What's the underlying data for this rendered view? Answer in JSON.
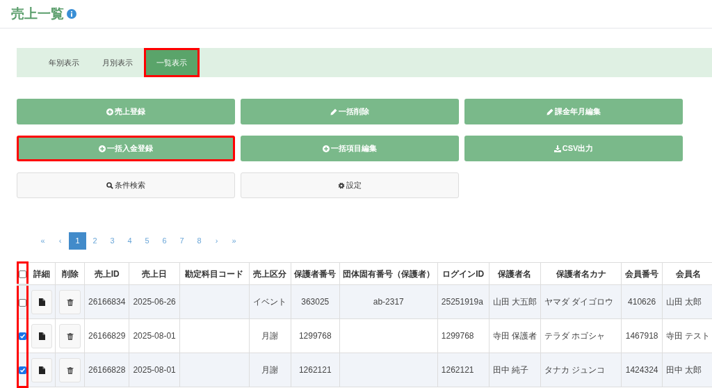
{
  "page_title": "売上一覧",
  "tabs": [
    {
      "label": "年別表示",
      "selected": false,
      "highlighted": false
    },
    {
      "label": "月別表示",
      "selected": false,
      "highlighted": false
    },
    {
      "label": "一覧表示",
      "selected": true,
      "highlighted": true
    }
  ],
  "buttons": [
    {
      "label": "売上登録",
      "highlighted": false
    },
    {
      "label": "一括削除",
      "highlighted": false
    },
    {
      "label": "課金年月編集",
      "highlighted": false
    },
    {
      "label": "一括入金登録",
      "highlighted": true
    },
    {
      "label": "一括項目編集",
      "highlighted": false
    },
    {
      "label": "CSV出力",
      "highlighted": false
    },
    {
      "label": "条件検索",
      "highlighted": false
    },
    {
      "label": "設定",
      "highlighted": false
    }
  ],
  "pagination": [
    {
      "label": "«",
      "selected": false
    },
    {
      "label": "‹",
      "selected": false
    },
    {
      "label": "1",
      "selected": true
    },
    {
      "label": "2",
      "selected": false
    },
    {
      "label": "3",
      "selected": false
    },
    {
      "label": "4",
      "selected": false
    },
    {
      "label": "5",
      "selected": false
    },
    {
      "label": "6",
      "selected": false
    },
    {
      "label": "7",
      "selected": false
    },
    {
      "label": "8",
      "selected": false
    },
    {
      "label": "›",
      "selected": false
    },
    {
      "label": "»",
      "selected": false
    }
  ],
  "table": {
    "checkbox_column_highlighted": true,
    "all_checked": false,
    "columns": [
      "詳細",
      "削除",
      "売上ID",
      "売上日",
      "勘定科目コード",
      "売上区分",
      "保護者番号",
      "団体固有番号（保護者）",
      "ログインID",
      "保護者名",
      "保護者名カナ",
      "会員番号",
      "会員名"
    ],
    "rows": [
      {
        "checked": false,
        "cells": [
          "",
          "",
          "26166834",
          "2025-06-26",
          "",
          "イベント",
          "363025",
          "ab-2317",
          "25251919a",
          "山田 大五郎",
          "ヤマダ ダイゴロウ",
          "410626",
          "山田 太郎"
        ]
      },
      {
        "checked": true,
        "cells": [
          "",
          "",
          "26166829",
          "2025-08-01",
          "",
          "月謝",
          "1299768",
          "",
          "1299768",
          "寺田 保護者",
          "テラダ ホゴシャ",
          "1467918",
          "寺田 テスト"
        ]
      },
      {
        "checked": true,
        "cells": [
          "",
          "",
          "26166828",
          "2025-08-01",
          "",
          "月謝",
          "1262121",
          "",
          "1262121",
          "田中 純子",
          "タナカ ジュンコ",
          "1424324",
          "田中 太郎"
        ]
      }
    ]
  }
}
